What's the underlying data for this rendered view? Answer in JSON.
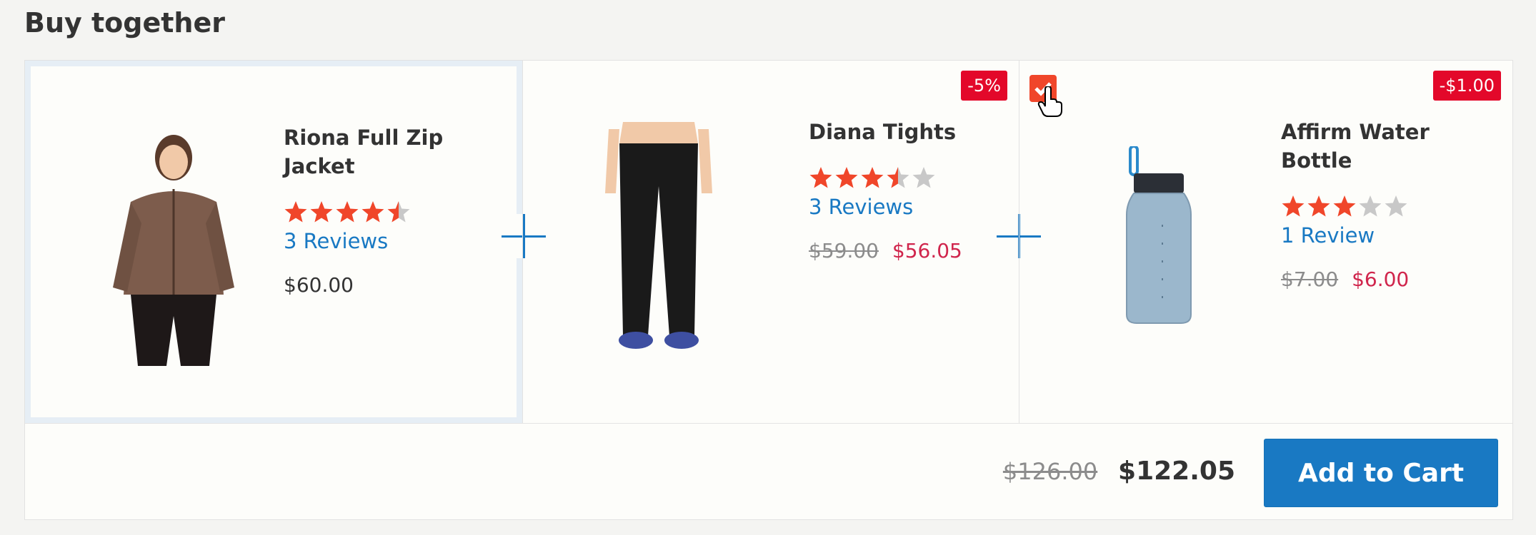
{
  "section_title": "Buy together",
  "products": [
    {
      "name": "Riona Full Zip Jacket",
      "rating": 4.5,
      "reviews": "3  Reviews",
      "old_price": "",
      "price": "$60.00",
      "badge": "",
      "selected": true
    },
    {
      "name": "Diana Tights",
      "rating": 3.5,
      "reviews": "3  Reviews",
      "old_price": "$59.00",
      "price": "$56.05",
      "badge": "-5%",
      "selected": false
    },
    {
      "name": "Affirm Water Bottle",
      "rating": 3,
      "reviews": "1  Review",
      "old_price": "$7.00",
      "price": "$6.00",
      "badge": "-$1.00",
      "selected": false,
      "checked": true
    }
  ],
  "total": {
    "old": "$126.00",
    "final": "$122.05"
  },
  "add_to_cart_label": "Add to Cart",
  "colors": {
    "accent": "#1979c3",
    "sale": "#d0254c",
    "badge": "#e3082a",
    "star": "#f0462a",
    "star_empty": "#c8c8c8"
  }
}
